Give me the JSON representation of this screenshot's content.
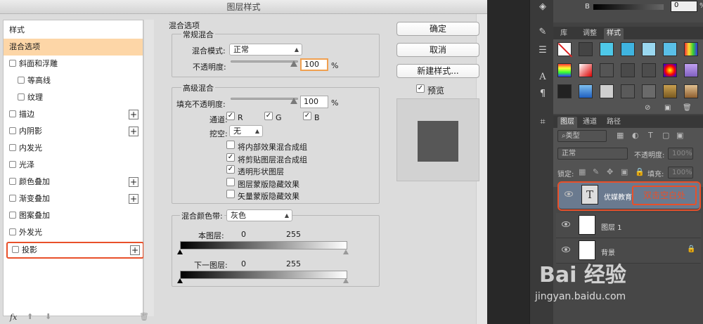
{
  "dialog": {
    "title": "图层样式",
    "style_list": {
      "items": [
        {
          "label": "样式",
          "checkbox": false,
          "plus": false
        },
        {
          "label": "混合选项",
          "checkbox": false,
          "plus": false,
          "selected": true
        },
        {
          "label": "斜面和浮雕",
          "checkbox": true,
          "plus": false
        },
        {
          "label": "等高线",
          "checkbox": true,
          "plus": false,
          "indent": true
        },
        {
          "label": "纹理",
          "checkbox": true,
          "plus": false,
          "indent": true
        },
        {
          "label": "描边",
          "checkbox": true,
          "plus": true
        },
        {
          "label": "内阴影",
          "checkbox": true,
          "plus": true
        },
        {
          "label": "内发光",
          "checkbox": true,
          "plus": false
        },
        {
          "label": "光泽",
          "checkbox": true,
          "plus": false
        },
        {
          "label": "颜色叠加",
          "checkbox": true,
          "plus": true
        },
        {
          "label": "渐变叠加",
          "checkbox": true,
          "plus": true
        },
        {
          "label": "图案叠加",
          "checkbox": true,
          "plus": false
        },
        {
          "label": "外发光",
          "checkbox": true,
          "plus": false
        },
        {
          "label": "投影",
          "checkbox": true,
          "plus": true,
          "highlighted": true
        }
      ],
      "footer_fx": "fx"
    },
    "blend_options": {
      "section_title": "混合选项",
      "general": {
        "title": "常规混合",
        "blend_mode_label": "混合模式:",
        "blend_mode_value": "正常",
        "opacity_label": "不透明度:",
        "opacity_value": "100",
        "percent": "%"
      },
      "advanced": {
        "title": "高级混合",
        "fill_opacity_label": "填充不透明度:",
        "fill_opacity_value": "100",
        "percent": "%",
        "channels_label": "通道:",
        "channels": [
          "R",
          "G",
          "B"
        ],
        "knockout_label": "挖空:",
        "knockout_value": "无",
        "options": [
          {
            "label": "将内部效果混合成组",
            "checked": false
          },
          {
            "label": "将剪贴图层混合成组",
            "checked": true
          },
          {
            "label": "透明形状图层",
            "checked": true
          },
          {
            "label": "图层蒙版隐藏效果",
            "checked": false
          },
          {
            "label": "矢量蒙版隐藏效果",
            "checked": false
          }
        ]
      },
      "blend_if": {
        "label": "混合颜色带:",
        "value": "灰色",
        "this_layer_label": "本图层:",
        "this_layer_min": "0",
        "this_layer_max": "255",
        "underlying_label": "下一图层:",
        "underlying_min": "0",
        "underlying_max": "255"
      }
    },
    "buttons": {
      "ok": "确定",
      "cancel": "取消",
      "new_style": "新建样式...",
      "preview_label": "预览",
      "preview_checked": true
    }
  },
  "panels": {
    "top_value": "0",
    "top_percent": "%",
    "top_letter": "B",
    "tabs_top": [
      "库",
      "调整",
      "样式"
    ],
    "tabs_layers": [
      "图层",
      "通道",
      "路径"
    ],
    "filter_label": "类型",
    "blend_mode": "正常",
    "opacity_label": "不透明度:",
    "opacity_value": "100%",
    "lock_label": "锁定:",
    "fill_label": "填充:",
    "fill_value": "100%",
    "layers": [
      {
        "name": "优媒教育",
        "type": "text",
        "selected": true,
        "annotation": "双击空白处"
      },
      {
        "name": "图层 1",
        "type": "pixel",
        "selected": false
      },
      {
        "name": "背景",
        "type": "background",
        "selected": false,
        "locked": true
      }
    ],
    "watermark": "Bai 经验",
    "watermark_url": "jingyan.baidu.com",
    "accent_color": "#e8502a",
    "selection_color": "#fdd6a7"
  }
}
